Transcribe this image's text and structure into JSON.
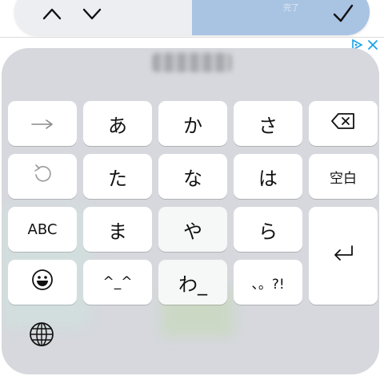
{
  "toolbar": {
    "up_icon": "chevron-up-icon",
    "down_icon": "chevron-down-icon",
    "blurred_label": "完了",
    "done_icon": "checkmark-icon",
    "accent_color": "#a9c3e2"
  },
  "ad": {
    "info_icon": "ad-choices-icon",
    "close_icon": "close-icon"
  },
  "keyboard": {
    "blurred_header": "",
    "rows": [
      [
        {
          "label": "",
          "icon": "right-arrow-icon"
        },
        {
          "label": "あ"
        },
        {
          "label": "か"
        },
        {
          "label": "さ"
        },
        {
          "label": "",
          "icon": "backspace-icon"
        }
      ],
      [
        {
          "label": "",
          "icon": "undo-icon"
        },
        {
          "label": "た"
        },
        {
          "label": "な"
        },
        {
          "label": "は"
        },
        {
          "label": "空白"
        }
      ],
      [
        {
          "label": "ABC"
        },
        {
          "label": "ま"
        },
        {
          "label": "や"
        },
        {
          "label": "ら"
        },
        {
          "label": "",
          "icon": "return-icon"
        }
      ],
      [
        {
          "label": "",
          "icon": "emoji-icon"
        },
        {
          "label": "^_^"
        },
        {
          "label": "わ_"
        },
        {
          "label": "、。?!"
        }
      ]
    ],
    "globe_icon": "globe-icon"
  }
}
